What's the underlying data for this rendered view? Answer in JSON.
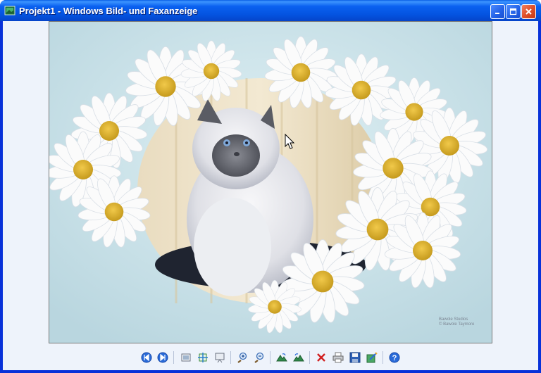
{
  "window": {
    "title": "Projekt1 - Windows Bild- und Faxanzeige",
    "controls": [
      "minimize",
      "maximize",
      "close"
    ],
    "accent": "#0a5fe6",
    "close_color": "#e0502a"
  },
  "image": {
    "subject": "Persian kitten among white daisies",
    "watermark_line1": "Bawole Studios",
    "watermark_line2": "© Bawole Taymore"
  },
  "toolbar": {
    "buttons": [
      {
        "name": "previous-image",
        "icon": "previous-icon"
      },
      {
        "name": "next-image",
        "icon": "next-icon"
      },
      {
        "name": "best-fit",
        "icon": "best-fit-icon"
      },
      {
        "name": "actual-size",
        "icon": "actual-size-icon"
      },
      {
        "name": "slideshow",
        "icon": "slideshow-icon"
      },
      {
        "name": "zoom-in",
        "icon": "zoom-in-icon"
      },
      {
        "name": "zoom-out",
        "icon": "zoom-out-icon"
      },
      {
        "name": "rotate-clockwise",
        "icon": "rotate-cw-icon"
      },
      {
        "name": "rotate-counterclockwise",
        "icon": "rotate-ccw-icon"
      },
      {
        "name": "delete",
        "icon": "delete-icon"
      },
      {
        "name": "print",
        "icon": "print-icon"
      },
      {
        "name": "save",
        "icon": "save-icon"
      },
      {
        "name": "edit",
        "icon": "edit-icon"
      },
      {
        "name": "help",
        "icon": "help-icon"
      }
    ]
  }
}
